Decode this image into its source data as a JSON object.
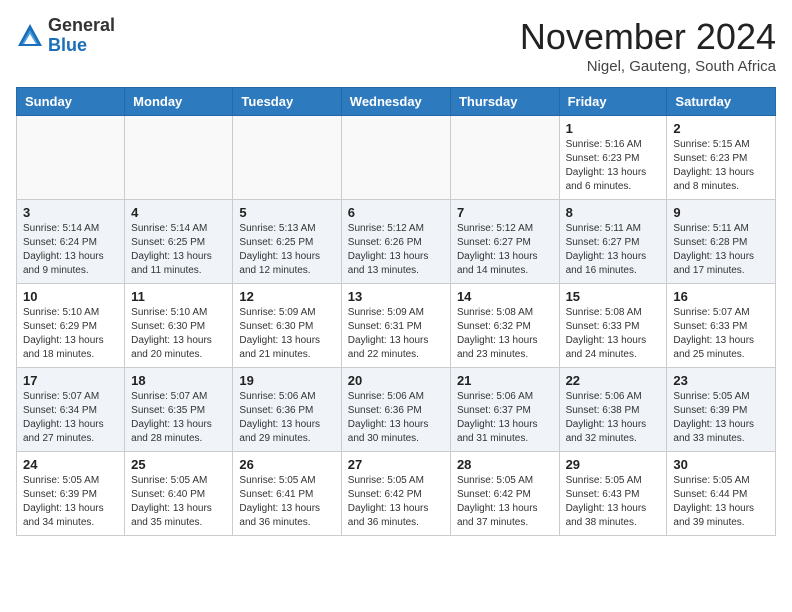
{
  "header": {
    "logo_general": "General",
    "logo_blue": "Blue",
    "month_title": "November 2024",
    "location": "Nigel, Gauteng, South Africa"
  },
  "weekdays": [
    "Sunday",
    "Monday",
    "Tuesday",
    "Wednesday",
    "Thursday",
    "Friday",
    "Saturday"
  ],
  "weeks": [
    [
      {
        "day": "",
        "info": ""
      },
      {
        "day": "",
        "info": ""
      },
      {
        "day": "",
        "info": ""
      },
      {
        "day": "",
        "info": ""
      },
      {
        "day": "",
        "info": ""
      },
      {
        "day": "1",
        "info": "Sunrise: 5:16 AM\nSunset: 6:23 PM\nDaylight: 13 hours\nand 6 minutes."
      },
      {
        "day": "2",
        "info": "Sunrise: 5:15 AM\nSunset: 6:23 PM\nDaylight: 13 hours\nand 8 minutes."
      }
    ],
    [
      {
        "day": "3",
        "info": "Sunrise: 5:14 AM\nSunset: 6:24 PM\nDaylight: 13 hours\nand 9 minutes."
      },
      {
        "day": "4",
        "info": "Sunrise: 5:14 AM\nSunset: 6:25 PM\nDaylight: 13 hours\nand 11 minutes."
      },
      {
        "day": "5",
        "info": "Sunrise: 5:13 AM\nSunset: 6:25 PM\nDaylight: 13 hours\nand 12 minutes."
      },
      {
        "day": "6",
        "info": "Sunrise: 5:12 AM\nSunset: 6:26 PM\nDaylight: 13 hours\nand 13 minutes."
      },
      {
        "day": "7",
        "info": "Sunrise: 5:12 AM\nSunset: 6:27 PM\nDaylight: 13 hours\nand 14 minutes."
      },
      {
        "day": "8",
        "info": "Sunrise: 5:11 AM\nSunset: 6:27 PM\nDaylight: 13 hours\nand 16 minutes."
      },
      {
        "day": "9",
        "info": "Sunrise: 5:11 AM\nSunset: 6:28 PM\nDaylight: 13 hours\nand 17 minutes."
      }
    ],
    [
      {
        "day": "10",
        "info": "Sunrise: 5:10 AM\nSunset: 6:29 PM\nDaylight: 13 hours\nand 18 minutes."
      },
      {
        "day": "11",
        "info": "Sunrise: 5:10 AM\nSunset: 6:30 PM\nDaylight: 13 hours\nand 20 minutes."
      },
      {
        "day": "12",
        "info": "Sunrise: 5:09 AM\nSunset: 6:30 PM\nDaylight: 13 hours\nand 21 minutes."
      },
      {
        "day": "13",
        "info": "Sunrise: 5:09 AM\nSunset: 6:31 PM\nDaylight: 13 hours\nand 22 minutes."
      },
      {
        "day": "14",
        "info": "Sunrise: 5:08 AM\nSunset: 6:32 PM\nDaylight: 13 hours\nand 23 minutes."
      },
      {
        "day": "15",
        "info": "Sunrise: 5:08 AM\nSunset: 6:33 PM\nDaylight: 13 hours\nand 24 minutes."
      },
      {
        "day": "16",
        "info": "Sunrise: 5:07 AM\nSunset: 6:33 PM\nDaylight: 13 hours\nand 25 minutes."
      }
    ],
    [
      {
        "day": "17",
        "info": "Sunrise: 5:07 AM\nSunset: 6:34 PM\nDaylight: 13 hours\nand 27 minutes."
      },
      {
        "day": "18",
        "info": "Sunrise: 5:07 AM\nSunset: 6:35 PM\nDaylight: 13 hours\nand 28 minutes."
      },
      {
        "day": "19",
        "info": "Sunrise: 5:06 AM\nSunset: 6:36 PM\nDaylight: 13 hours\nand 29 minutes."
      },
      {
        "day": "20",
        "info": "Sunrise: 5:06 AM\nSunset: 6:36 PM\nDaylight: 13 hours\nand 30 minutes."
      },
      {
        "day": "21",
        "info": "Sunrise: 5:06 AM\nSunset: 6:37 PM\nDaylight: 13 hours\nand 31 minutes."
      },
      {
        "day": "22",
        "info": "Sunrise: 5:06 AM\nSunset: 6:38 PM\nDaylight: 13 hours\nand 32 minutes."
      },
      {
        "day": "23",
        "info": "Sunrise: 5:05 AM\nSunset: 6:39 PM\nDaylight: 13 hours\nand 33 minutes."
      }
    ],
    [
      {
        "day": "24",
        "info": "Sunrise: 5:05 AM\nSunset: 6:39 PM\nDaylight: 13 hours\nand 34 minutes."
      },
      {
        "day": "25",
        "info": "Sunrise: 5:05 AM\nSunset: 6:40 PM\nDaylight: 13 hours\nand 35 minutes."
      },
      {
        "day": "26",
        "info": "Sunrise: 5:05 AM\nSunset: 6:41 PM\nDaylight: 13 hours\nand 36 minutes."
      },
      {
        "day": "27",
        "info": "Sunrise: 5:05 AM\nSunset: 6:42 PM\nDaylight: 13 hours\nand 36 minutes."
      },
      {
        "day": "28",
        "info": "Sunrise: 5:05 AM\nSunset: 6:42 PM\nDaylight: 13 hours\nand 37 minutes."
      },
      {
        "day": "29",
        "info": "Sunrise: 5:05 AM\nSunset: 6:43 PM\nDaylight: 13 hours\nand 38 minutes."
      },
      {
        "day": "30",
        "info": "Sunrise: 5:05 AM\nSunset: 6:44 PM\nDaylight: 13 hours\nand 39 minutes."
      }
    ]
  ]
}
